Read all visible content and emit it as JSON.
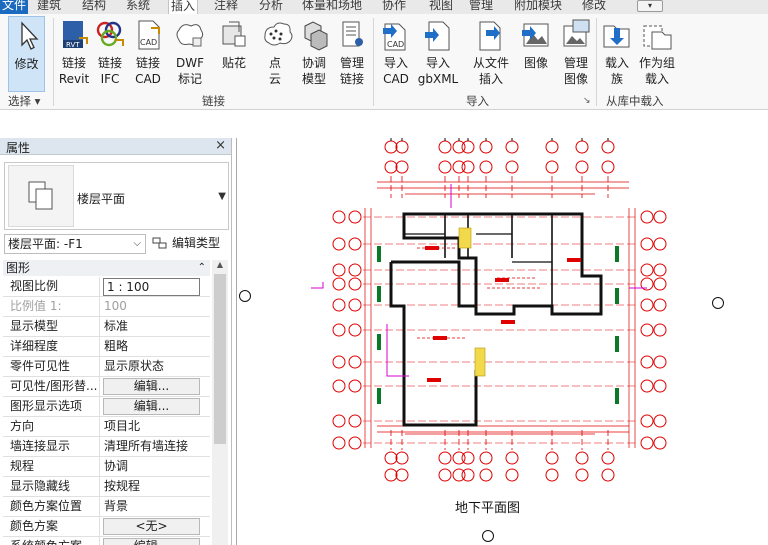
{
  "tabs": [
    {
      "label": "文件",
      "kind": "file"
    },
    {
      "label": "建筑"
    },
    {
      "label": "结构"
    },
    {
      "label": "系统"
    },
    {
      "label": "插入",
      "kind": "active"
    },
    {
      "label": "注释"
    },
    {
      "label": "分析"
    },
    {
      "label": "体量和场地"
    },
    {
      "label": "协作"
    },
    {
      "label": "视图"
    },
    {
      "label": "管理"
    },
    {
      "label": "附加模块"
    },
    {
      "label": "修改"
    }
  ],
  "ribbon": {
    "modify": {
      "label": "修改"
    },
    "select_group": "选择",
    "link": {
      "items": [
        {
          "label": "链接\nRevit",
          "icon": "link-revit-icon"
        },
        {
          "label": "链接\nIFC",
          "icon": "link-ifc-icon"
        },
        {
          "label": "链接\nCAD",
          "icon": "link-cad-icon"
        },
        {
          "label": "DWF\n标记",
          "icon": "dwf-markup-icon"
        },
        {
          "label": "贴花",
          "icon": "decal-icon"
        },
        {
          "label": "点\n云",
          "icon": "point-cloud-icon"
        },
        {
          "label": "协调\n模型",
          "icon": "coordination-model-icon"
        },
        {
          "label": "管理\n链接",
          "icon": "manage-links-icon"
        }
      ],
      "group": "链接"
    },
    "import": {
      "items": [
        {
          "label": "导入\nCAD",
          "icon": "import-cad-icon"
        },
        {
          "label": "导入\ngbXML",
          "icon": "import-gbxml-icon"
        },
        {
          "label": "从文件\n插入",
          "icon": "insert-from-file-icon"
        },
        {
          "label": "图像",
          "icon": "image-icon"
        },
        {
          "label": "管理\n图像",
          "icon": "manage-images-icon"
        }
      ],
      "group": "导入"
    },
    "library": {
      "items": [
        {
          "label": "载入\n族",
          "icon": "load-family-icon"
        },
        {
          "label": "作为组\n载入",
          "icon": "load-as-group-icon"
        }
      ],
      "group": "从库中载入"
    },
    "tab_menu_button": "▾"
  },
  "properties": {
    "title": "属性",
    "close": "×",
    "type_name": "楼层平面",
    "instance_filter": "楼层平面: -F1",
    "edit_type": "编辑类型",
    "category": "图形",
    "rows": [
      {
        "key": "视图比例",
        "value": "1 : 100",
        "style": "boxed"
      },
      {
        "key": "比例值 1:",
        "value": "100",
        "style": "dim"
      },
      {
        "key": "显示模型",
        "value": "标准"
      },
      {
        "key": "详细程度",
        "value": "粗略"
      },
      {
        "key": "零件可见性",
        "value": "显示原状态"
      },
      {
        "key": "可见性/图形替...",
        "value": "编辑...",
        "style": "btn"
      },
      {
        "key": "图形显示选项",
        "value": "编辑...",
        "style": "btn"
      },
      {
        "key": "方向",
        "value": "项目北"
      },
      {
        "key": "墙连接显示",
        "value": "清理所有墙连接"
      },
      {
        "key": "规程",
        "value": "协调"
      },
      {
        "key": "显示隐藏线",
        "value": "按规程"
      },
      {
        "key": "颜色方案位置",
        "value": "背景"
      },
      {
        "key": "颜色方案",
        "value": "<无>",
        "style": "btn"
      },
      {
        "key": "系统颜色方案",
        "value": "编辑...",
        "style": "btn"
      }
    ]
  },
  "view": {
    "title": "地下平面图",
    "colors": {
      "grid": "#e00000",
      "wall": "#111111",
      "accent": "#d400d4"
    }
  }
}
